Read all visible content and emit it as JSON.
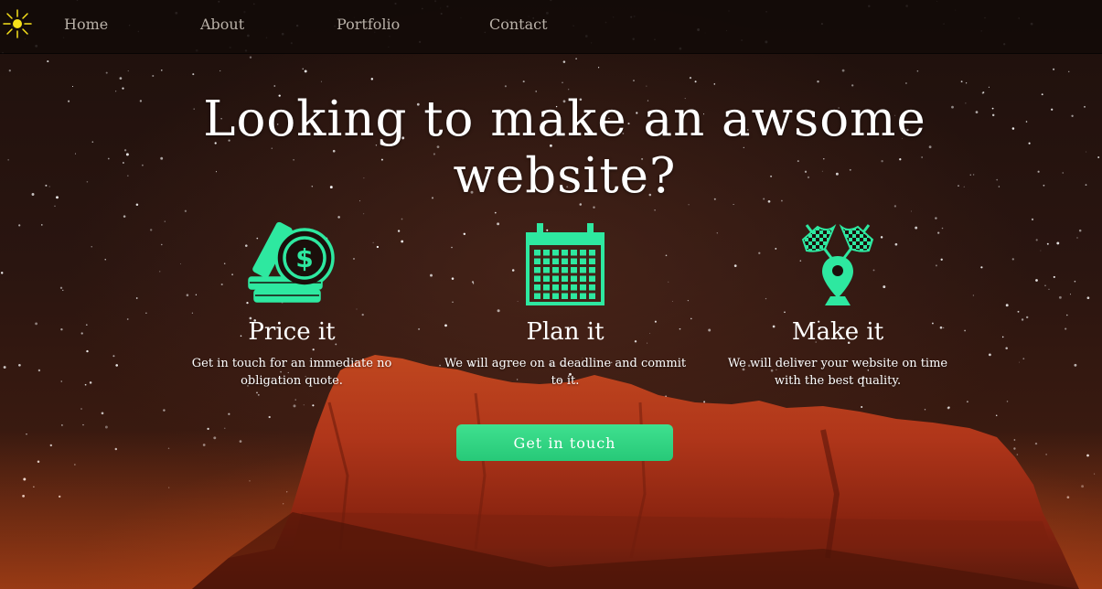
{
  "nav": {
    "items": [
      {
        "label": "Home"
      },
      {
        "label": "About"
      },
      {
        "label": "Portfolio"
      },
      {
        "label": "Contact"
      }
    ]
  },
  "hero": {
    "headline": "Looking to make an awsome website?",
    "features": [
      {
        "icon": "coins-dollar-icon",
        "title": "Price it",
        "text": "Get in touch for an immediate no obligation quote."
      },
      {
        "icon": "calendar-icon",
        "title": "Plan it",
        "text": "We will agree on a deadline and commit to it."
      },
      {
        "icon": "checkered-flags-pin-icon",
        "title": "Make it",
        "text": "We will deliver your website on time with the best quality."
      }
    ],
    "cta_label": "Get in touch"
  },
  "colors": {
    "accent": "#2edb8a",
    "icon_green": "#2ee8a0",
    "logo_yellow": "#f7e21a",
    "nav_bg": "#120a08"
  }
}
